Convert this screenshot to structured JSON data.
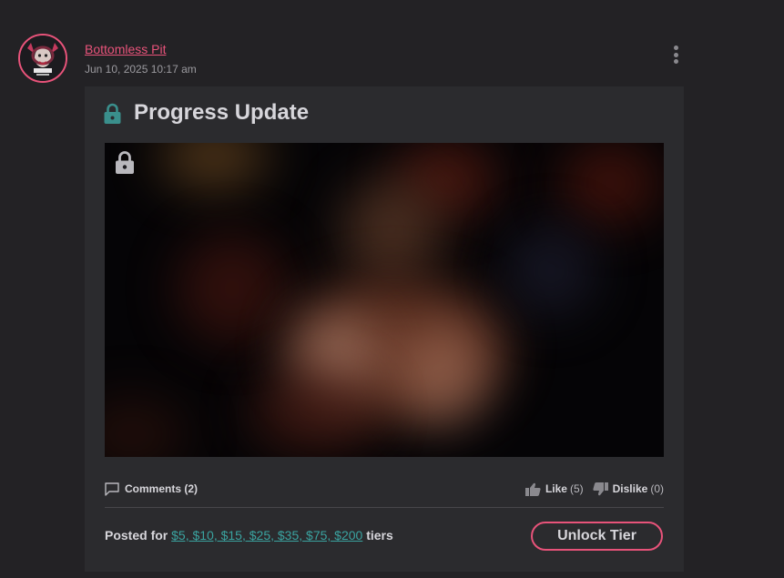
{
  "post": {
    "author": "Bottomless Pit",
    "date": "Jun 10, 2025 10:17 am",
    "title": "Progress Update",
    "comments_label": "Comments (2)",
    "like_label": "Like",
    "like_count": "(5)",
    "dislike_label": "Dislike",
    "dislike_count": "(0)",
    "posted_for_prefix": "Posted for",
    "tiers_link": "$5, $10, $15, $25, $35, $75, $200",
    "tiers_suffix": "tiers",
    "unlock_label": "Unlock Tier"
  },
  "icons": {
    "title_lock": "lock-icon",
    "media_lock": "lock-icon",
    "comments": "comment-icon",
    "like": "thumbs-up-icon",
    "dislike": "thumbs-down-icon",
    "menu": "kebab-menu-icon"
  },
  "colors": {
    "accent": "#e8537a",
    "lock_teal": "#3a8f8c",
    "link_teal": "#3aa3a0",
    "background": "#232225",
    "card": "#2b2b2e"
  }
}
